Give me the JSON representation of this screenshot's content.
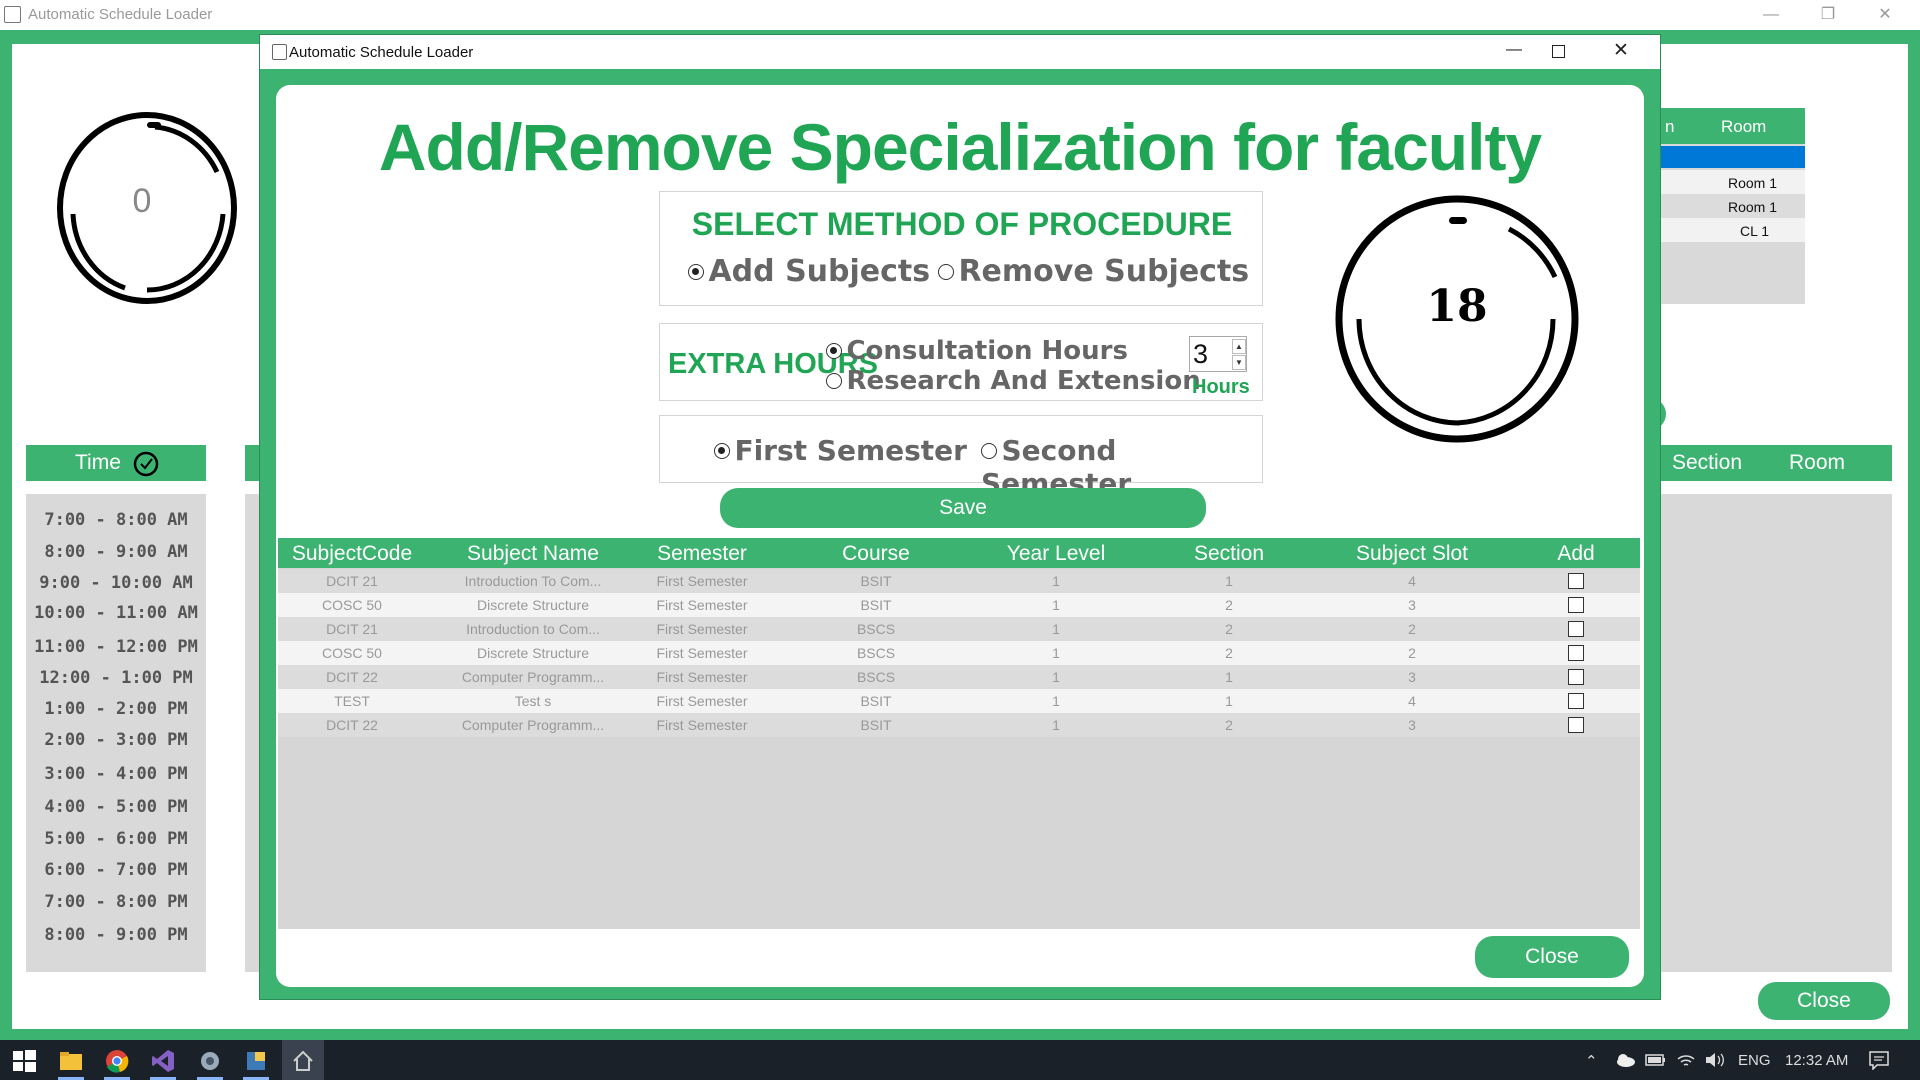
{
  "background_window": {
    "title": "Automatic Schedule Loader",
    "counter_value": "0",
    "time_header": "Time",
    "time_slots": [
      "7:00 - 8:00 AM",
      "8:00 - 9:00 AM",
      "9:00 - 10:00 AM",
      "10:00 - 11:00 AM",
      "11:00 - 12:00 PM",
      "12:00 - 1:00 PM",
      "1:00 - 2:00 PM",
      "2:00 - 3:00 PM",
      "3:00 - 4:00 PM",
      "4:00 - 5:00 PM",
      "5:00 - 6:00 PM",
      "6:00 - 7:00 PM",
      "7:00 - 8:00 PM",
      "8:00 - 9:00 PM"
    ],
    "top_right_table": {
      "headers": [
        "n",
        "Room"
      ],
      "rooms": [
        "Room 1",
        "Room 1",
        "CL 1"
      ]
    },
    "bottom_right_headers": [
      "Section",
      "Room"
    ],
    "close_label": "Close"
  },
  "dialog": {
    "title": "Automatic Schedule Loader",
    "heading": "Add/Remove Specialization for faculty",
    "method": {
      "title": "SELECT METHOD OF PROCEDURE",
      "options": [
        "Add Subjects",
        "Remove Subjects"
      ],
      "selected": "Add Subjects"
    },
    "extra_hours": {
      "label": "EXTRA HOURS",
      "options": [
        "Consultation Hours",
        "Research And Extension"
      ],
      "selected": "Consultation Hours",
      "hours_value": "3",
      "hours_label": "Hours"
    },
    "semester": {
      "options": [
        "First Semester",
        "Second Semester"
      ],
      "selected": "First Semester"
    },
    "counter_value": "18",
    "save_label": "Save",
    "close_label": "Close",
    "table": {
      "headers": [
        "SubjectCode",
        "Subject Name",
        "Semester",
        "Course",
        "Year Level",
        "Section",
        "Subject Slot",
        "Add"
      ],
      "rows": [
        [
          "DCIT 21",
          "Introduction To Com...",
          "First Semester",
          "BSIT",
          "1",
          "1",
          "4"
        ],
        [
          "COSC 50",
          "Discrete Structure",
          "First Semester",
          "BSIT",
          "1",
          "2",
          "3"
        ],
        [
          "DCIT 21",
          "Introduction to Com...",
          "First Semester",
          "BSCS",
          "1",
          "2",
          "2"
        ],
        [
          "COSC 50",
          "Discrete Structure",
          "First Semester",
          "BSCS",
          "1",
          "2",
          "2"
        ],
        [
          "DCIT 22",
          "Computer Programm...",
          "First Semester",
          "BSCS",
          "1",
          "1",
          "3"
        ],
        [
          "TEST",
          "Test s",
          "First Semester",
          "BSIT",
          "1",
          "1",
          "4"
        ],
        [
          "DCIT 22",
          "Computer Programm...",
          "First Semester",
          "BSIT",
          "1",
          "2",
          "3"
        ]
      ]
    }
  },
  "taskbar": {
    "language": "ENG",
    "clock": "12:32 AM"
  }
}
